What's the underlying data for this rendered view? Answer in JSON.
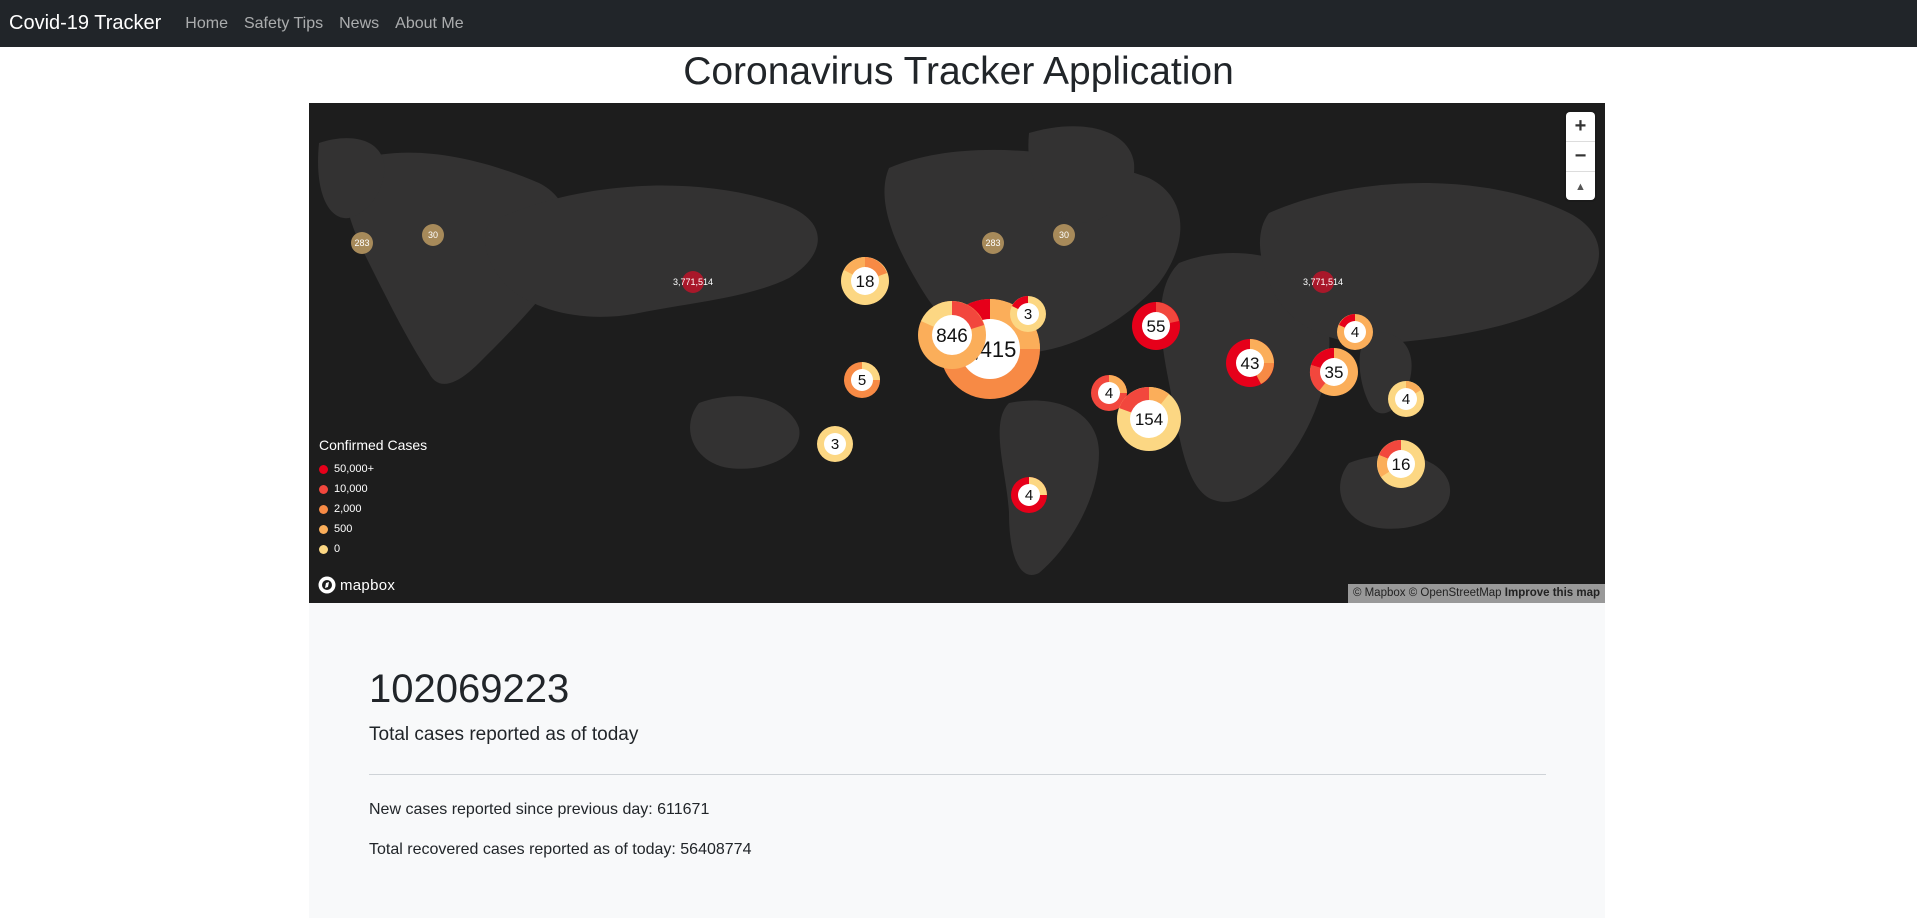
{
  "navbar": {
    "brand": "Covid-19 Tracker",
    "links": [
      "Home",
      "Safety Tips",
      "News",
      "About Me"
    ]
  },
  "page_title": "Coronavirus Tracker Application",
  "map": {
    "zoom_in_label": "+",
    "zoom_out_label": "−",
    "compass_label": "▲",
    "legend": {
      "title": "Confirmed Cases",
      "items": [
        {
          "label": "50,000+",
          "color": "#e6001a"
        },
        {
          "label": "10,000",
          "color": "#f2473d"
        },
        {
          "label": "2,000",
          "color": "#f78a45"
        },
        {
          "label": "500",
          "color": "#fbae5a"
        },
        {
          "label": "0",
          "color": "#fcd783"
        }
      ]
    },
    "logo_text": "mapbox",
    "attribution": "© Mapbox © OpenStreetMap",
    "improve_link": "Improve this map",
    "clusters": [
      {
        "label": "18"
      },
      {
        "label": "846"
      },
      {
        "label": ",415"
      },
      {
        "label": "3"
      },
      {
        "label": "5"
      },
      {
        "label": "3"
      },
      {
        "label": "55"
      },
      {
        "label": "4"
      },
      {
        "label": "154"
      },
      {
        "label": "43"
      },
      {
        "label": "35"
      },
      {
        "label": "4"
      },
      {
        "label": "4"
      },
      {
        "label": "16"
      },
      {
        "label": "4"
      }
    ],
    "small_markers": [
      {
        "label": "283"
      },
      {
        "label": "30"
      },
      {
        "label": "283"
      },
      {
        "label": "30"
      },
      {
        "label": "3,771,514"
      },
      {
        "label": "3,771,514"
      }
    ]
  },
  "stats": {
    "total_cases": "102069223",
    "total_cases_label": "Total cases reported as of today",
    "new_cases_line": "New cases reported since previous day: 611671",
    "recovered_line": "Total recovered cases reported as of today: 56408774"
  }
}
